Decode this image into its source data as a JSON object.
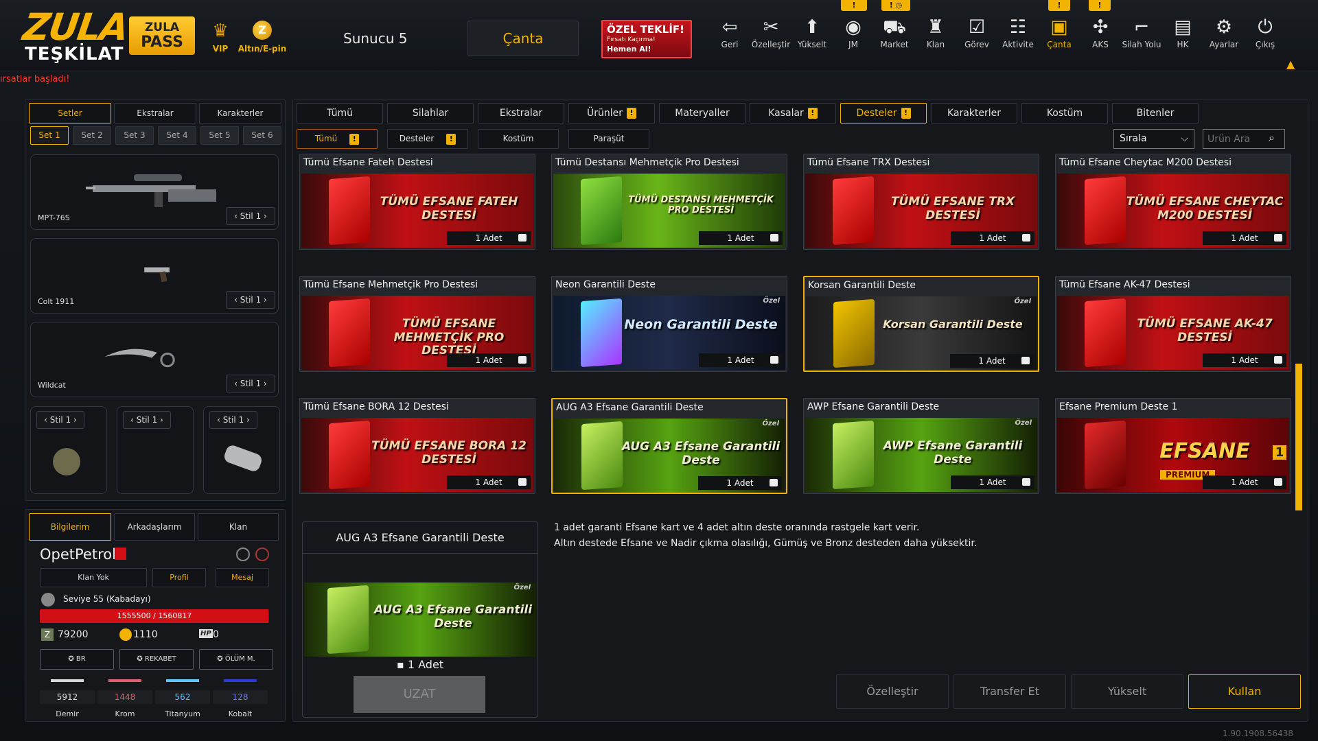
{
  "header": {
    "logo_top": "ZULA",
    "logo_bottom": "TEŞKİLAT",
    "pass_line1": "ZULA",
    "pass_line2": "PASS",
    "vip_label": "VIP",
    "altin_label": "Altın/E-pin",
    "server": "Sunucu 5",
    "canta_button": "Çanta",
    "offer_title": "ÖZEL TEKLİF!",
    "offer_sub": "Fırsatı Kaçırma!",
    "offer_cta": "Hemen Al!",
    "ticker": "ırsatlar başladı!",
    "nav": [
      {
        "label": "Geri",
        "icon": "back-icon"
      },
      {
        "label": "Özelleştir",
        "icon": "tools-icon"
      },
      {
        "label": "Yükselt",
        "icon": "rank-up-icon"
      },
      {
        "label": "JM",
        "icon": "jm-icon"
      },
      {
        "label": "Market",
        "icon": "cart-icon"
      },
      {
        "label": "Klan",
        "icon": "clan-icon"
      },
      {
        "label": "Görev",
        "icon": "mission-icon"
      },
      {
        "label": "Aktivite",
        "icon": "activity-icon"
      },
      {
        "label": "Çanta",
        "icon": "bag-icon"
      },
      {
        "label": "AKS",
        "icon": "aks-icon"
      },
      {
        "label": "Silah Yolu",
        "icon": "gun-path-icon"
      },
      {
        "label": "HK",
        "icon": "hk-icon"
      },
      {
        "label": "Ayarlar",
        "icon": "gear-icon"
      },
      {
        "label": "Çıkış",
        "icon": "power-icon"
      }
    ],
    "badge_mark": "!"
  },
  "left": {
    "tabs": [
      "Setler",
      "Ekstralar",
      "Karakterler"
    ],
    "sets": [
      "Set 1",
      "Set 2",
      "Set 3",
      "Set 4",
      "Set 5",
      "Set 6"
    ],
    "weapons": [
      {
        "name": "MPT-76S",
        "style": "Stil 1"
      },
      {
        "name": "Colt 1911",
        "style": "Stil 1"
      },
      {
        "name": "Wildcat",
        "style": "Stil 1"
      }
    ],
    "small_styles": [
      "Stil 1",
      "Stil 1",
      "Stil 1"
    ]
  },
  "profile": {
    "tabs": [
      "Bilgilerim",
      "Arkadaşlarım",
      "Klan"
    ],
    "username": "OpetPetrol",
    "clan": "Klan Yok",
    "profile_btn": "Profil",
    "message_btn": "Mesaj",
    "level": "Seviye 55 (Kabadayı)",
    "xp_text": "1555500 / 1560817",
    "xp_progress": 0.9966,
    "zp": "79200",
    "gold": "1110",
    "hp_label": "HP",
    "hp": "0",
    "medals": [
      "BR",
      "REKABET",
      "ÖLÜM M."
    ],
    "materials": [
      {
        "value": "5912",
        "label": "Demir",
        "color": "#d8d8d8"
      },
      {
        "value": "1448",
        "label": "Krom",
        "color": "#e06070"
      },
      {
        "value": "562",
        "label": "Titanyum",
        "color": "#5fc6ff"
      },
      {
        "value": "128",
        "label": "Kobalt",
        "color": "#2a3ad8"
      }
    ]
  },
  "main": {
    "categories": [
      "Tümü",
      "Silahlar",
      "Ekstralar",
      "Ürünler",
      "Materyaller",
      "Kasalar",
      "Desteler",
      "Karakterler",
      "Kostüm",
      "Bitenler"
    ],
    "filters": [
      "Tümü",
      "Desteler",
      "Kostüm",
      "Paraşüt"
    ],
    "sort_label": "Sırala",
    "search_placeholder": "Ürün Ara",
    "cards": [
      {
        "title": "Tümü Efsane Fateh Destesi",
        "art": "TÜMÜ EFSANE FATEH DESTESİ",
        "qty": "1 Adet",
        "theme": "red"
      },
      {
        "title": "Tümü Destansı Mehmetçik Pro Destesi",
        "art": "TÜMÜ DESTANSI MEHMETÇİK PRO DESTESİ",
        "qty": "1 Adet",
        "theme": "green"
      },
      {
        "title": "Tümü Efsane TRX Destesi",
        "art": "TÜMÜ EFSANE TRX DESTESİ",
        "qty": "1 Adet",
        "theme": "red"
      },
      {
        "title": "Tümü Efsane Cheytac M200 Destesi",
        "art": "TÜMÜ EFSANE CHEYTAC M200 DESTESİ",
        "qty": "1 Adet",
        "theme": "red"
      },
      {
        "title": "Tümü Efsane Mehmetçik Pro Destesi",
        "art": "TÜMÜ EFSANE MEHMETÇİK PRO DESTESİ",
        "qty": "1 Adet",
        "theme": "red"
      },
      {
        "title": "Neon Garantili Deste",
        "art": "Neon Garantili Deste",
        "qty": "1 Adet",
        "theme": "neon",
        "tag": "Özel"
      },
      {
        "title": "Korsan Garantili Deste",
        "art": "Korsan Garantili Deste",
        "qty": "1 Adet",
        "theme": "pirate",
        "tag": "Özel"
      },
      {
        "title": "Tümü Efsane AK-47 Destesi",
        "art": "TÜMÜ EFSANE AK-47 DESTESİ",
        "qty": "1 Adet",
        "theme": "red"
      },
      {
        "title": "Tümü Efsane BORA 12 Destesi",
        "art": "TÜMÜ EFSANE BORA 12 DESTESİ",
        "qty": "1 Adet",
        "theme": "red"
      },
      {
        "title": "AUG A3 Efsane Garantili Deste",
        "art": "AUG A3 Efsane Garantili Deste",
        "qty": "1 Adet",
        "theme": "lime",
        "tag": "Özel"
      },
      {
        "title": "AWP Efsane Garantili Deste",
        "art": "AWP Efsane Garantili Deste",
        "qty": "1 Adet",
        "theme": "lime",
        "tag": "Özel"
      },
      {
        "title": "Efsane Premium Deste 1",
        "art": "EFSANE",
        "qty": "1 Adet",
        "theme": "premium",
        "tag": "PREMIUM",
        "num": "1"
      }
    ],
    "detail": {
      "title": "AUG A3 Efsane Garantili Deste",
      "art": "AUG A3 Efsane Garantili Deste",
      "tag": "Özel",
      "qty": "1 Adet",
      "extend": "UZAT"
    },
    "description": [
      "1 adet garanti Efsane kart ve 4 adet altın deste oranında rastgele kart verir.",
      "Altın destede Efsane ve Nadir çıkma olasılığı, Gümüş ve Bronz desteden daha yüksektir."
    ],
    "actions": [
      "Özelleştir",
      "Transfer Et",
      "Yükselt",
      "Kullan"
    ],
    "version": "1.90.1908.56438"
  },
  "colors": {
    "accent": "#f2b300",
    "danger": "#d10f15"
  }
}
